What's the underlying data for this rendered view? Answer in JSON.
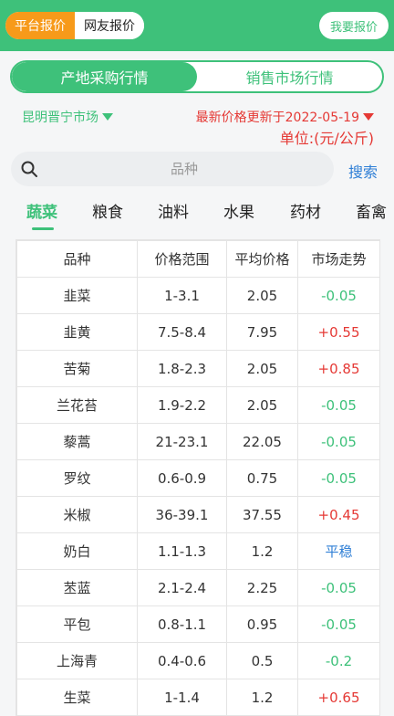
{
  "header": {
    "tab_platform": "平台报价",
    "tab_user": "网友报价",
    "quote_button": "我要报价"
  },
  "main_tabs": [
    "产地采购行情",
    "销售市场行情"
  ],
  "market": {
    "name": "昆明晋宁市场",
    "updated": "最新价格更新于2022-05-19",
    "unit": "单位:(元/公斤)"
  },
  "search": {
    "placeholder": "品种",
    "button": "搜索"
  },
  "categories": [
    "蔬菜",
    "粮食",
    "油料",
    "水果",
    "药材",
    "畜禽"
  ],
  "table": {
    "headers": [
      "品种",
      "价格范围",
      "平均价格",
      "市场走势"
    ],
    "rows": [
      {
        "name": "韭菜",
        "range": "1-3.1",
        "avg": "2.05",
        "trend": "-0.05",
        "dir": "down"
      },
      {
        "name": "韭黄",
        "range": "7.5-8.4",
        "avg": "7.95",
        "trend": "+0.55",
        "dir": "up"
      },
      {
        "name": "苦菊",
        "range": "1.8-2.3",
        "avg": "2.05",
        "trend": "+0.85",
        "dir": "up"
      },
      {
        "name": "兰花苔",
        "range": "1.9-2.2",
        "avg": "2.05",
        "trend": "-0.05",
        "dir": "down"
      },
      {
        "name": "藜蒿",
        "range": "21-23.1",
        "avg": "22.05",
        "trend": "-0.05",
        "dir": "down"
      },
      {
        "name": "罗纹",
        "range": "0.6-0.9",
        "avg": "0.75",
        "trend": "-0.05",
        "dir": "down"
      },
      {
        "name": "米椒",
        "range": "36-39.1",
        "avg": "37.55",
        "trend": "+0.45",
        "dir": "up"
      },
      {
        "name": "奶白",
        "range": "1.1-1.3",
        "avg": "1.2",
        "trend": "平稳",
        "dir": "flat"
      },
      {
        "name": "苤蓝",
        "range": "2.1-2.4",
        "avg": "2.25",
        "trend": "-0.05",
        "dir": "down"
      },
      {
        "name": "平包",
        "range": "0.8-1.1",
        "avg": "0.95",
        "trend": "-0.05",
        "dir": "down"
      },
      {
        "name": "上海青",
        "range": "0.4-0.6",
        "avg": "0.5",
        "trend": "-0.2",
        "dir": "down"
      },
      {
        "name": "生菜",
        "range": "1-1.4",
        "avg": "1.2",
        "trend": "+0.65",
        "dir": "up"
      }
    ]
  },
  "colors": {
    "brand_green": "#3ec17a",
    "orange": "#f79a1a",
    "red": "#e53935",
    "blue": "#2f7fd6"
  }
}
